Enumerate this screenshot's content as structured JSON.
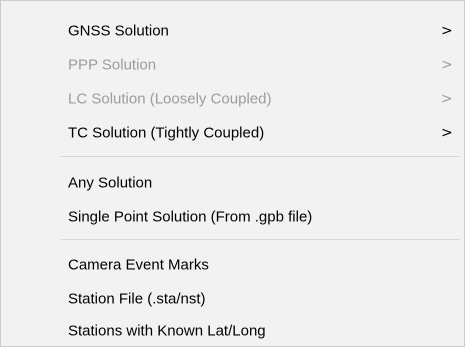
{
  "menu": {
    "items": [
      {
        "label": "GNSS Solution",
        "arrow": ">",
        "enabled": true
      },
      {
        "label": "PPP Solution",
        "arrow": ">",
        "enabled": false
      },
      {
        "label": "LC Solution (Loosely Coupled)",
        "arrow": ">",
        "enabled": false
      },
      {
        "label": "TC Solution (Tightly Coupled)",
        "arrow": ">",
        "enabled": true
      },
      {
        "label": "Any Solution",
        "enabled": true
      },
      {
        "label": "Single Point Solution (From .gpb file)",
        "enabled": true
      },
      {
        "label": "Camera Event Marks",
        "enabled": true
      },
      {
        "label": "Station File (.sta/nst)",
        "enabled": true
      },
      {
        "label": "Stations with Known Lat/Long",
        "enabled": true
      }
    ]
  },
  "colors": {
    "menu_background": "#f2f2f2",
    "text": "#000000",
    "disabled_text": "#9c9c9c",
    "separator": "#d7d7d7"
  }
}
